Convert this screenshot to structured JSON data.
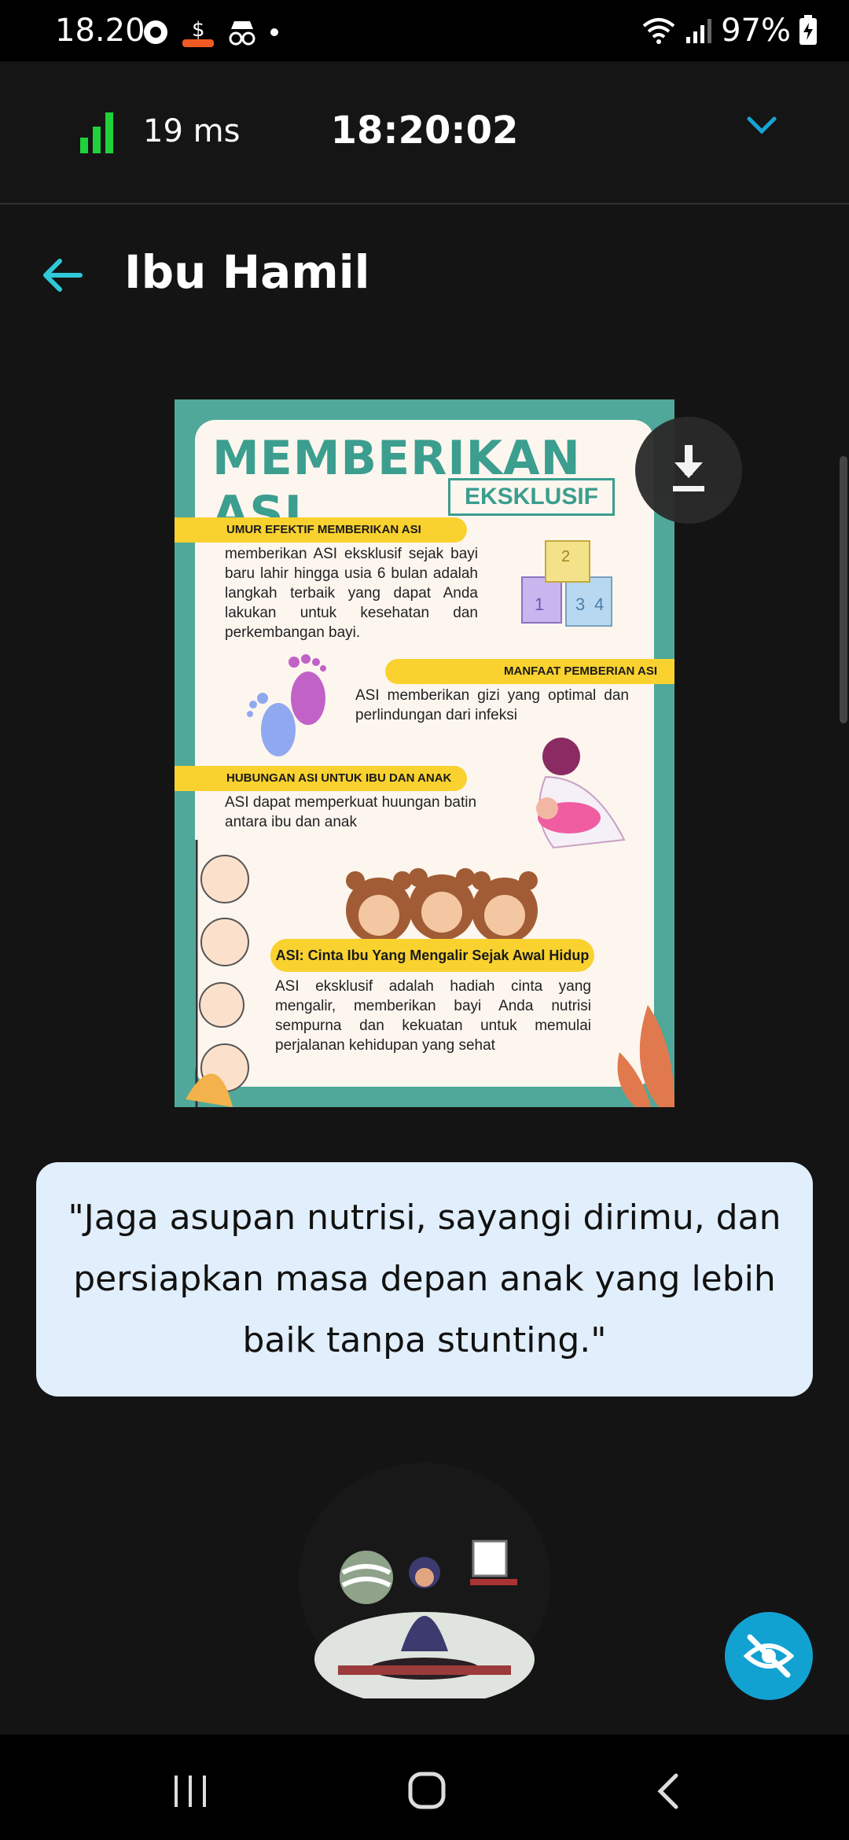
{
  "status_bar": {
    "time": "18.20",
    "battery": "97%"
  },
  "info_bar": {
    "ping": "19 ms",
    "clock": "18:20:02"
  },
  "header": {
    "title": "Ibu Hamil"
  },
  "poster": {
    "title": "MEMBERIKAN ASI",
    "subtitle": "EKSKLUSIF",
    "section1_heading": "UMUR EFEKTIF MEMBERIKAN ASI",
    "section1_text": "memberikan ASI eksklusif sejak bayi baru lahir hingga usia 6 bulan adalah langkah terbaik yang dapat Anda lakukan untuk kesehatan dan perkembangan bayi.",
    "section2_heading": "MANFAAT PEMBERIAN ASI",
    "section2_text": "ASI memberikan gizi yang optimal dan perlindungan dari infeksi",
    "section3_heading": "HUBUNGAN ASI UNTUK IBU DAN ANAK",
    "section3_text": "ASI dapat memperkuat huungan batin antara ibu dan anak",
    "section4_heading": "ASI: Cinta Ibu Yang Mengalir Sejak Awal Hidup",
    "section4_text": "ASI eksklusif adalah hadiah cinta yang mengalir, memberikan bayi Anda nutrisi sempurna dan kekuatan untuk memulai perjalanan kehidupan yang sehat",
    "block_numbers": [
      "1",
      "2",
      "3",
      "4"
    ]
  },
  "quote": {
    "text": "\"Jaga asupan nutrisi, sayangi dirimu, dan persiapkan masa depan anak yang lebih baik tanpa stunting.\""
  },
  "colors": {
    "accent": "#2ec9d8",
    "fab": "#12a2d1",
    "quote_bg": "#e1eefb",
    "poster_teal": "#4fa89a",
    "band_yellow": "#f9d22f"
  },
  "icons": {
    "back": "arrow-left-icon",
    "download": "download-icon",
    "fab": "eye-off-icon",
    "signal": "signal-bars-icon",
    "expand": "chevron-down-icon"
  }
}
